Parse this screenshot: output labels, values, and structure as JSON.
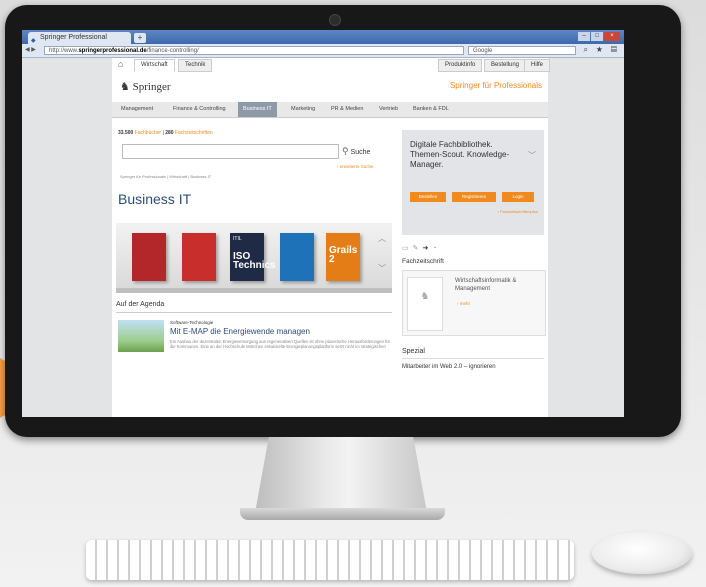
{
  "browser": {
    "tab_title": "Springer Professional",
    "newtab_label": "+",
    "url_prefix": "http://www.",
    "url_domain": "springerprofessional.de",
    "url_path": "/finance-controlling/",
    "search_placeholder": "Google",
    "nav_back": "◀ ▶",
    "nav_icons": "⌕ ★ ▤"
  },
  "page": {
    "top_nav": [
      "Wirtschaft",
      "Technik"
    ],
    "top_right": [
      "Produktinfo",
      "Bestellung",
      "Hilfe"
    ],
    "logo_text": "Springer",
    "tagline": "Springer für Professionals",
    "main_nav": [
      "Management",
      "Finance & Controlling",
      "Business IT",
      "Marketing",
      "PR & Medien",
      "Vertrieb",
      "Banken & FDL"
    ],
    "active_nav": "Business IT",
    "counts": {
      "books_count": "33.500",
      "books_label": "Fachbücher",
      "sep": "|",
      "journals_count": "280",
      "journals_label": "Fachzeitschriften"
    },
    "search_button": "Suche",
    "advanced_search": "› erweiterte Suche",
    "breadcrumb": "Springer für Professionals | Wirtschaft | Business IT",
    "title": "Business IT",
    "books": [
      {
        "title": "",
        "big": ""
      },
      {
        "title": "",
        "big": ""
      },
      {
        "title": "ITIL",
        "big": "ISO Technics"
      },
      {
        "title": "",
        "big": ""
      },
      {
        "title": "",
        "big": "Grails 2"
      }
    ],
    "agenda": {
      "heading": "Auf der Agenda",
      "kicker": "Software-Technologie",
      "title": "Mit E-MAP die Energiewende managen",
      "text": "Ein Ausbau der dezentralen Energieversorgung aus regenerativen Quellen ist ohne planerische Herausforderungen für die Kommunen. Eine an der Hochschule München entwickelte Energieplanungsplattform setzt nicht im strategischen"
    },
    "promo": {
      "title": "Digitale Fachbibliothek. Themen-Scout. Knowledge-Manager.",
      "buttons": [
        "Bestellen",
        "Registrieren",
        "Login"
      ],
      "link": "› Fachzeitschriftenplan"
    },
    "fachzeitschrift": {
      "heading": "Fachzeitschrift",
      "title": "Wirtschaftsinformatik & Management",
      "more": "› mehr"
    },
    "spezial": {
      "heading": "Spezial",
      "text": "Mitarbeiter im Web 2.0 – ignorieren"
    }
  }
}
